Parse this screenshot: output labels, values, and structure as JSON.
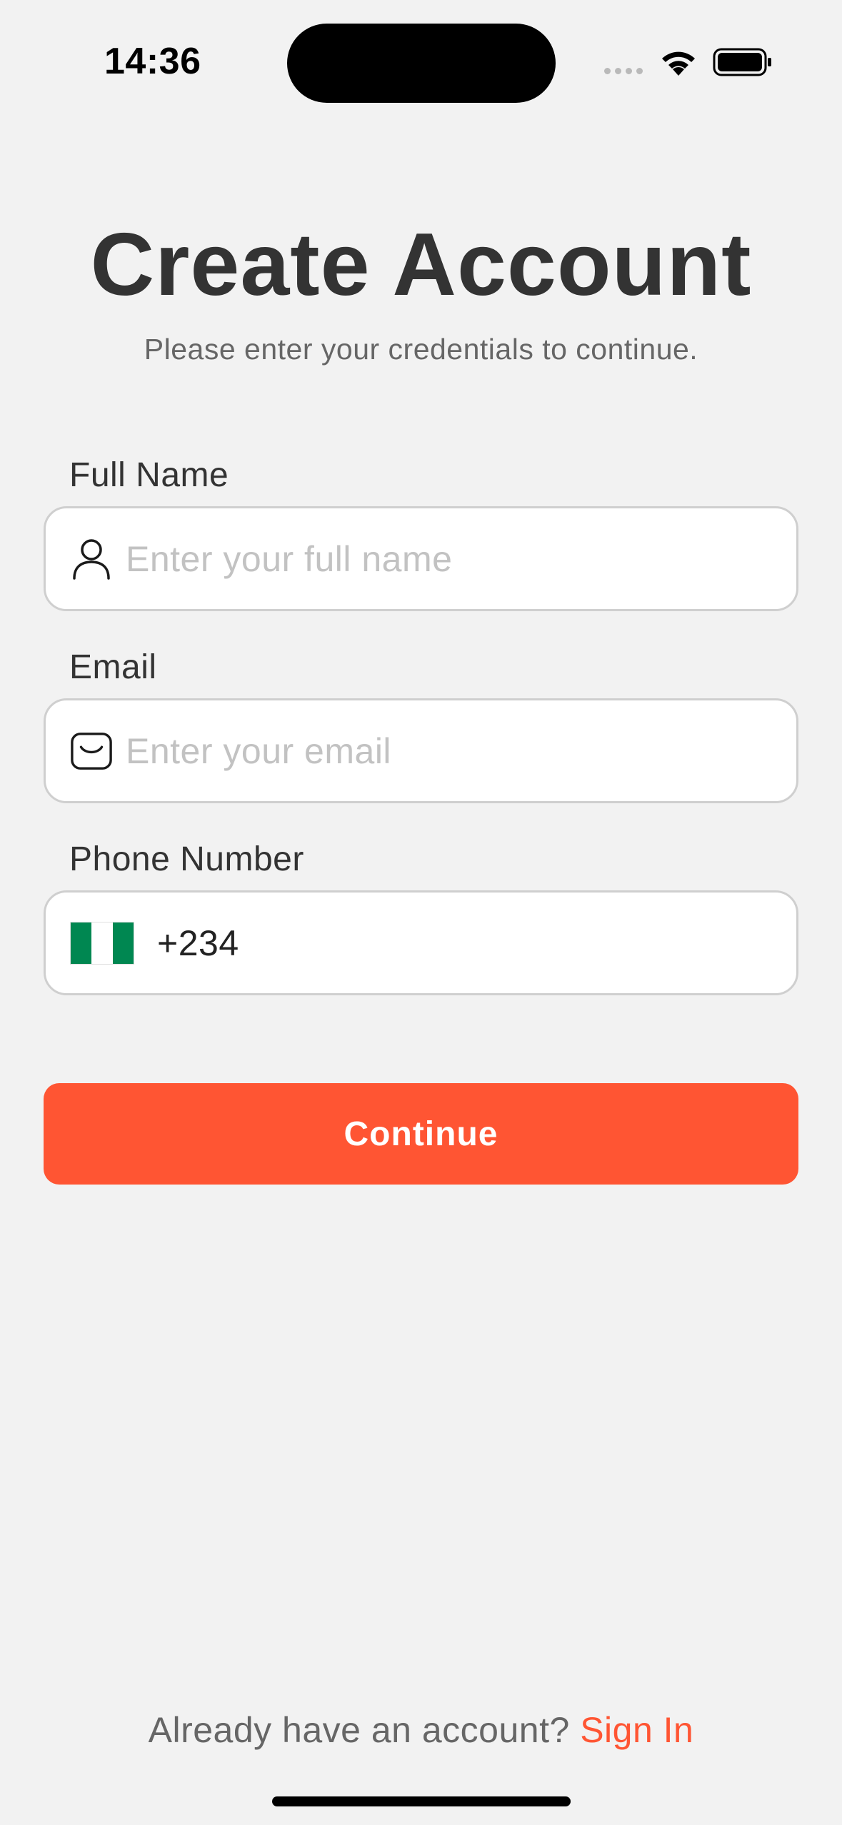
{
  "status_bar": {
    "time": "14:36"
  },
  "header": {
    "title": "Create Account",
    "subtitle": "Please enter your credentials to continue."
  },
  "form": {
    "full_name": {
      "label": "Full Name",
      "placeholder": "Enter your full name",
      "icon": "user-icon"
    },
    "email": {
      "label": "Email",
      "placeholder": "Enter your email",
      "icon": "mail-icon"
    },
    "phone": {
      "label": "Phone Number",
      "country": "Nigeria",
      "dial_code": "+234",
      "icon": "nigeria-flag-icon"
    }
  },
  "actions": {
    "continue_label": "Continue"
  },
  "footer": {
    "prompt": "Already have an account?",
    "link": "Sign In"
  },
  "colors": {
    "accent": "#ff5533",
    "background": "#f2f2f2",
    "flag_green": "#008751"
  }
}
